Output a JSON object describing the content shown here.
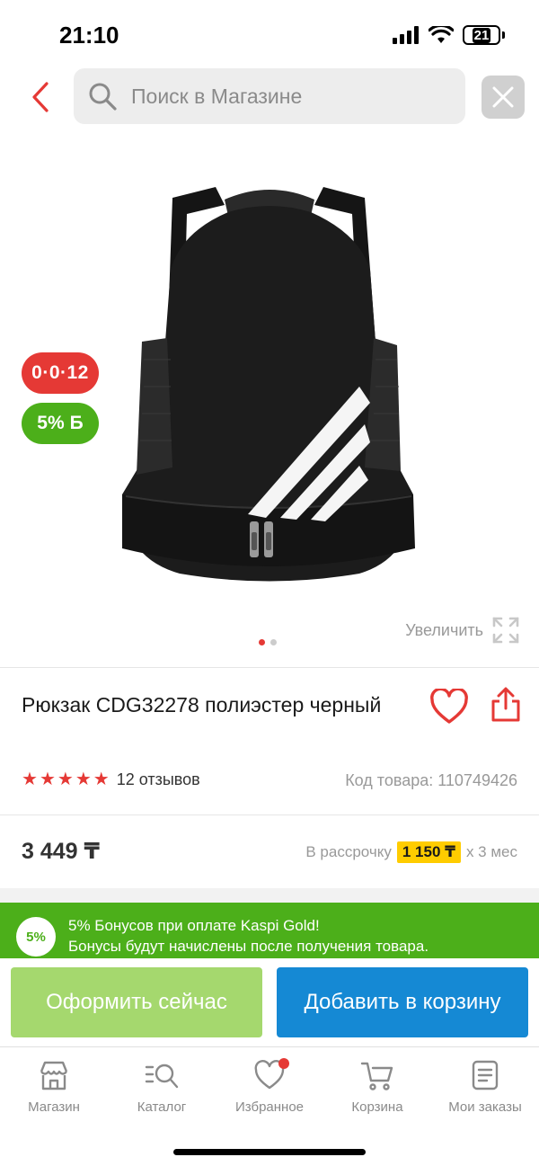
{
  "status_bar": {
    "time": "21:10",
    "battery": "21"
  },
  "search": {
    "placeholder": "Поиск в Магазине"
  },
  "product": {
    "badge_installment": "0·0·12",
    "badge_bonus_value": "5%",
    "badge_bonus_currency": "Б",
    "zoom_label": "Увеличить",
    "title": "Рюкзак CDG32278 полиэстер черный",
    "rating_stars": 5,
    "reviews": "12 отзывов",
    "code": "Код товара: 110749426",
    "price": "3 449 ₸",
    "installment_prefix": "В рассрочку",
    "installment_amount": "1 150 ₸",
    "installment_suffix": "х 3 мес",
    "images_total": 2,
    "images_active": 1
  },
  "promo": {
    "badge": "5%",
    "line1": "5% Бонусов при оплате Kaspi Gold!",
    "line2": "Бонусы будут начислены после получения товара."
  },
  "actions": {
    "buy_now": "Оформить сейчас",
    "add_to_cart": "Добавить в корзину"
  },
  "tabbar": {
    "items": [
      {
        "label": "Магазин",
        "icon": "store-icon"
      },
      {
        "label": "Каталог",
        "icon": "catalog-search-icon"
      },
      {
        "label": "Избранное",
        "icon": "heart-icon"
      },
      {
        "label": "Корзина",
        "icon": "cart-icon"
      },
      {
        "label": "Мои заказы",
        "icon": "orders-icon"
      }
    ]
  },
  "colors": {
    "accent_red": "#e53935",
    "bonus_green": "#4caf1a",
    "buy_green": "#a5d86e",
    "cart_blue": "#1589d4",
    "installment_yellow": "#ffcc00"
  }
}
